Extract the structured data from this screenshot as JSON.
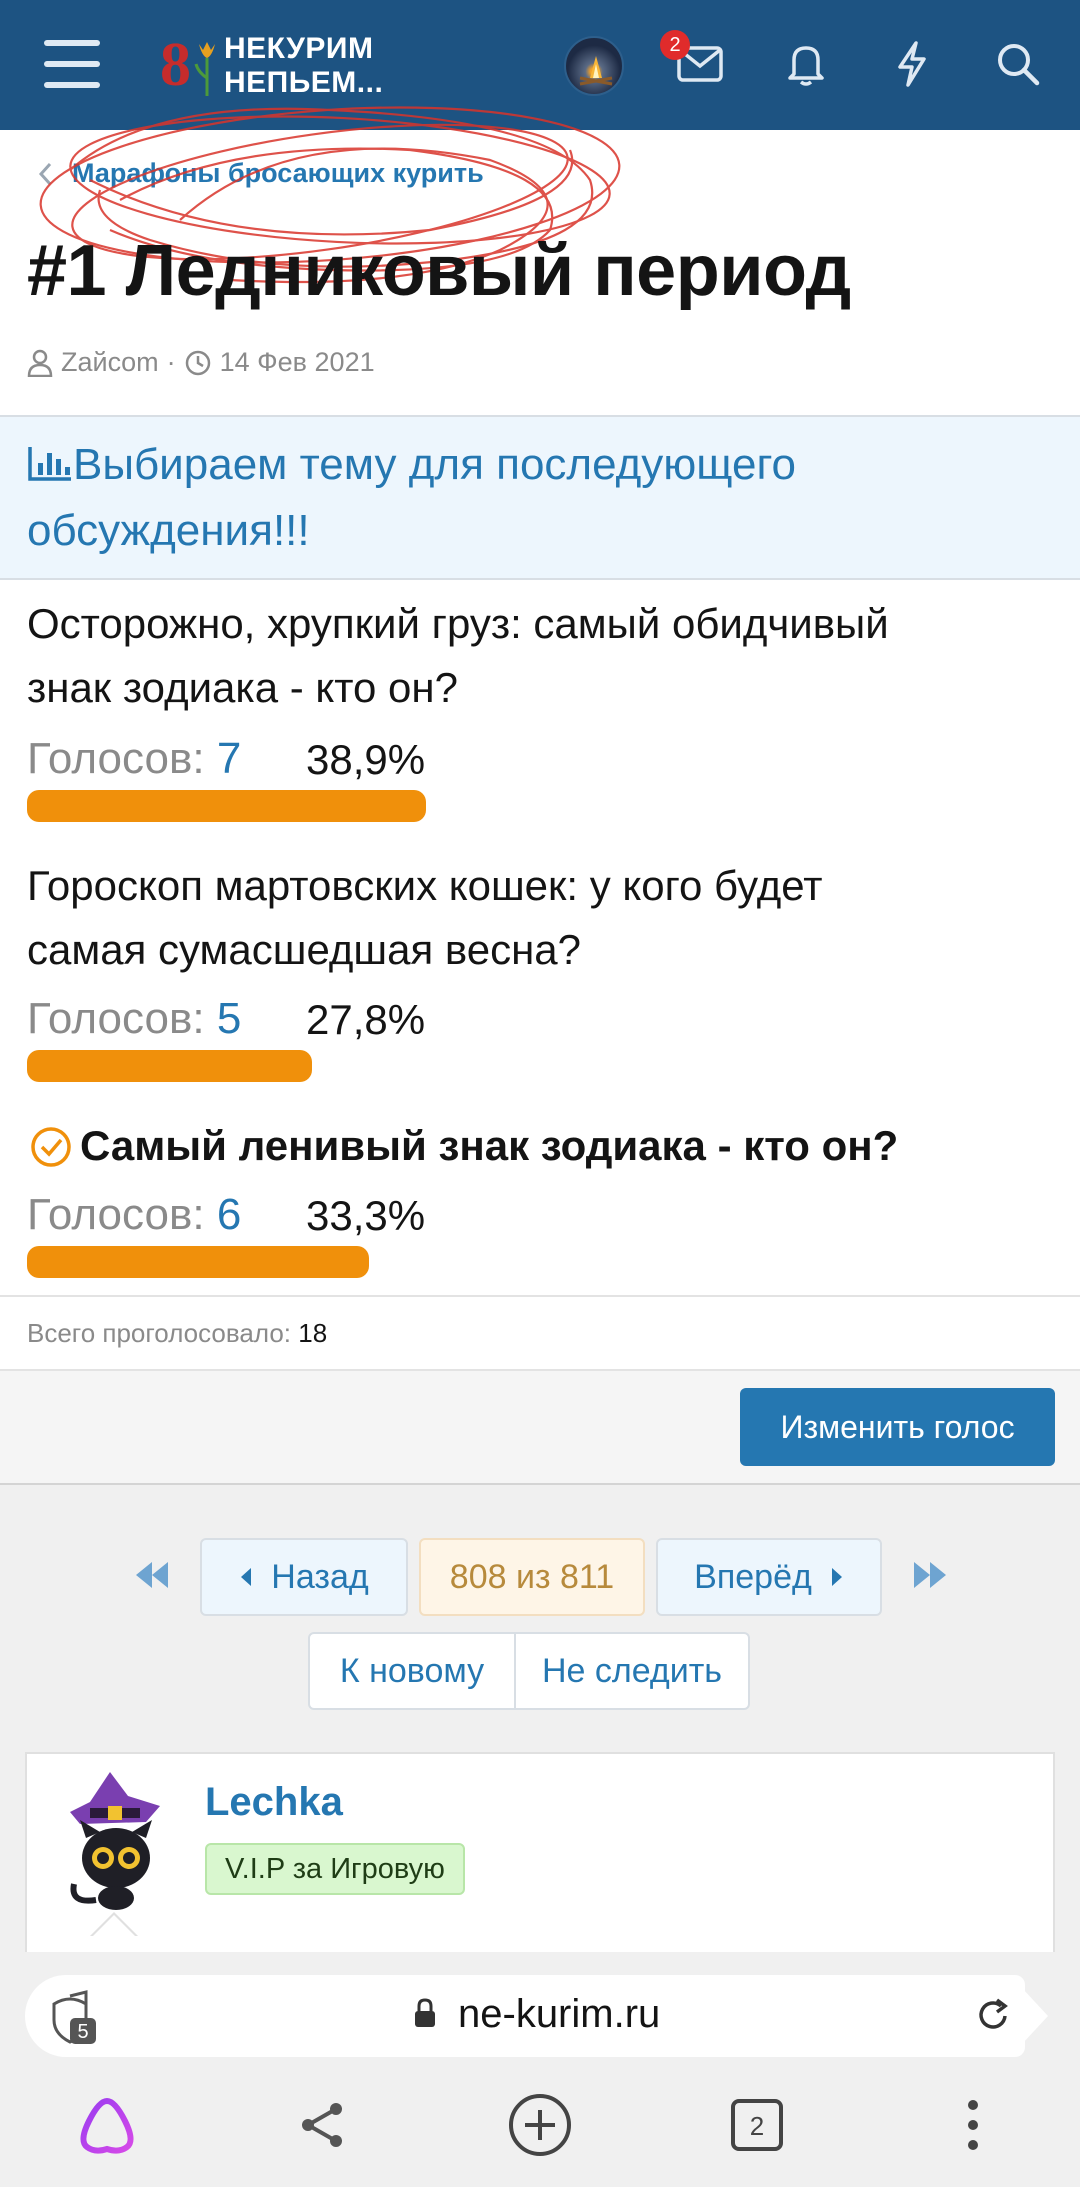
{
  "header": {
    "logo_line1": "НЕКУРИМ",
    "logo_line2": "НЕПЬЕМ...",
    "logo_digit": "8",
    "notification_count": "2",
    "icons": [
      "menu-icon",
      "inbox-icon",
      "bell-icon",
      "bolt-icon",
      "search-icon"
    ]
  },
  "breadcrumb": {
    "label": "Марафоны бросающих курить"
  },
  "thread": {
    "title": "#1 Ледниковый период",
    "author": "Zайсom",
    "separator": "·",
    "date": "14 Фев 2021"
  },
  "poll": {
    "title_line1": "Выбираем тему для последующего",
    "title_line2": "обсуждения!!!",
    "votes_label": "Голосов:",
    "options": [
      {
        "line1": "Осторожно, хрупкий груз: самый обидчивый",
        "line2": "знак зодиака - кто он?",
        "votes": "7",
        "percent": "38,9%",
        "share": 0.389,
        "selected": false
      },
      {
        "line1": "Гороскоп мартовских кошек: у кого будет",
        "line2": "самая сумасшедшая весна?",
        "votes": "5",
        "percent": "27,8%",
        "share": 0.278,
        "selected": false
      },
      {
        "line1": "Самый ленивый знак зодиака - кто он?",
        "line2": "",
        "votes": "6",
        "percent": "33,3%",
        "share": 0.333,
        "selected": true
      }
    ],
    "total_label": "Всего проголосовало:",
    "total": "18",
    "change_vote": "Изменить голос"
  },
  "pager": {
    "prev": "Назад",
    "current": "808 из 811",
    "next": "Вперёд",
    "to_new": "К новому",
    "unwatch": "Не следить"
  },
  "post": {
    "username": "Lechka",
    "user_title": "V.I.P за Игровую"
  },
  "browser": {
    "url": "ne-kurim.ru",
    "shield_count": "5",
    "tabs_count": "2",
    "icons": [
      "shield-icon",
      "lock-icon",
      "reload-icon",
      "alice-icon",
      "share-icon",
      "new-tab-icon",
      "tabs-icon",
      "more-icon"
    ]
  }
}
